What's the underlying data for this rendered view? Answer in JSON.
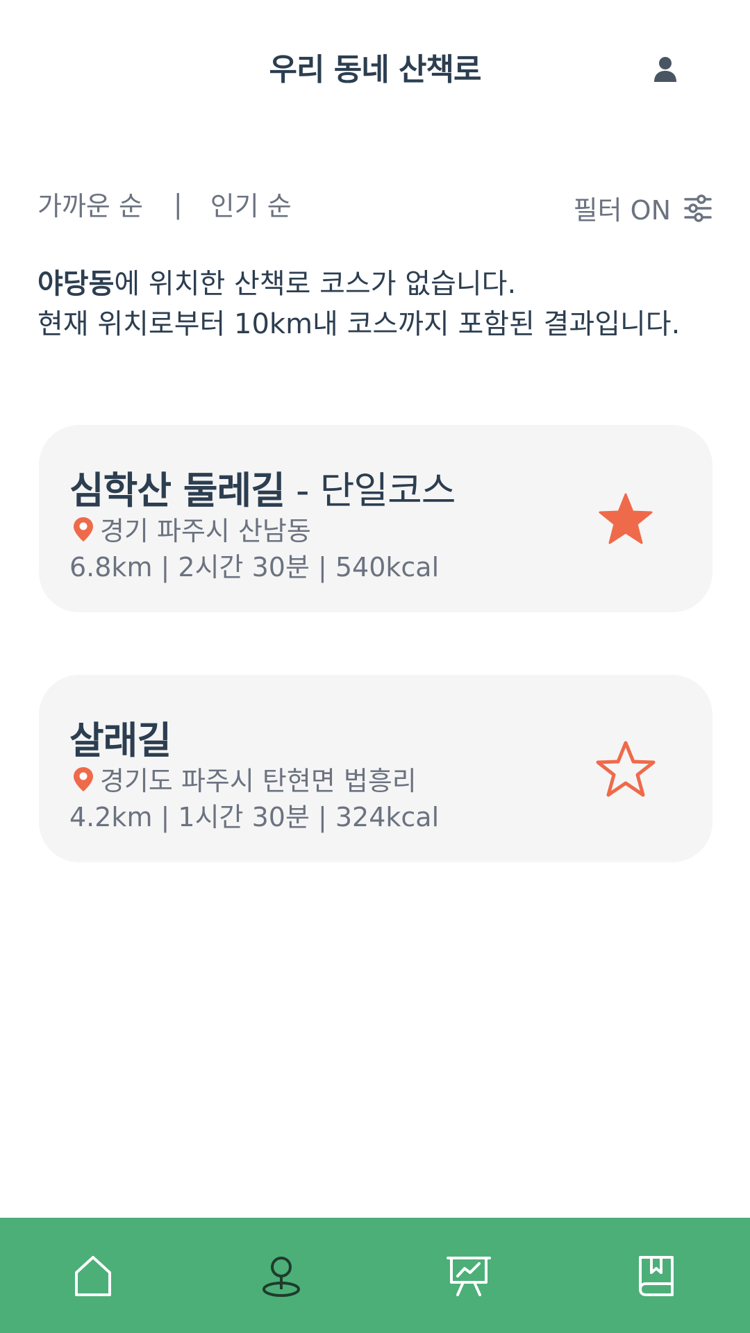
{
  "header": {
    "title": "우리 동네 산책로",
    "profile_icon": "user-icon"
  },
  "sort": {
    "nearest": "가까운 순",
    "divider": "|",
    "popular": "인기 순"
  },
  "filter": {
    "label": "필터 ON",
    "icon": "sliders-icon"
  },
  "notice": {
    "location": "야당동",
    "line1_rest": "에 위치한 산책로 코스가 없습니다.",
    "line2": "현재 위치로부터 10km내 코스까지 포함된 결과입니다."
  },
  "courses": [
    {
      "name": "심학산 둘레길",
      "type": " - 단일코스",
      "location": "경기 파주시 산남동",
      "stats": "6.8km | 2시간 30분 | 540kcal",
      "favorited": true
    },
    {
      "name": "살래길",
      "type": "",
      "location": "경기도 파주시 탄현면 법흥리",
      "stats": "4.2km | 1시간 30분 | 324kcal",
      "favorited": false
    }
  ],
  "colors": {
    "accent": "#ef6a4a",
    "nav_background": "#4caf78",
    "card_background": "#f5f5f5",
    "text_primary": "#2c3e50",
    "text_secondary": "#6b7280"
  },
  "bottom_nav": [
    {
      "icon": "home-icon"
    },
    {
      "icon": "map-pin-icon"
    },
    {
      "icon": "presentation-chart-icon"
    },
    {
      "icon": "book-icon"
    }
  ]
}
